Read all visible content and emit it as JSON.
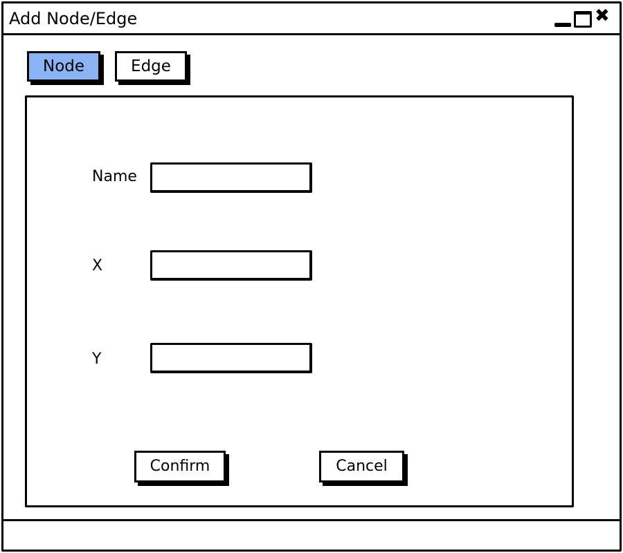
{
  "window": {
    "title": "Add Node/Edge",
    "controls": {
      "minimize_icon": "minimize-icon",
      "maximize_icon": "maximize-icon",
      "close_glyph": "✖"
    }
  },
  "tabs": [
    {
      "label": "Node",
      "selected": true
    },
    {
      "label": "Edge",
      "selected": false
    }
  ],
  "colors": {
    "selected_tab": "#8cb4f5",
    "border": "#000000",
    "background": "#ffffff"
  },
  "form": {
    "fields": [
      {
        "label": "Name",
        "value": "",
        "placeholder": ""
      },
      {
        "label": "X",
        "value": "",
        "placeholder": ""
      },
      {
        "label": "Y",
        "value": "",
        "placeholder": ""
      }
    ]
  },
  "buttons": {
    "confirm": "Confirm",
    "cancel": "Cancel"
  },
  "status": {
    "text": ""
  }
}
